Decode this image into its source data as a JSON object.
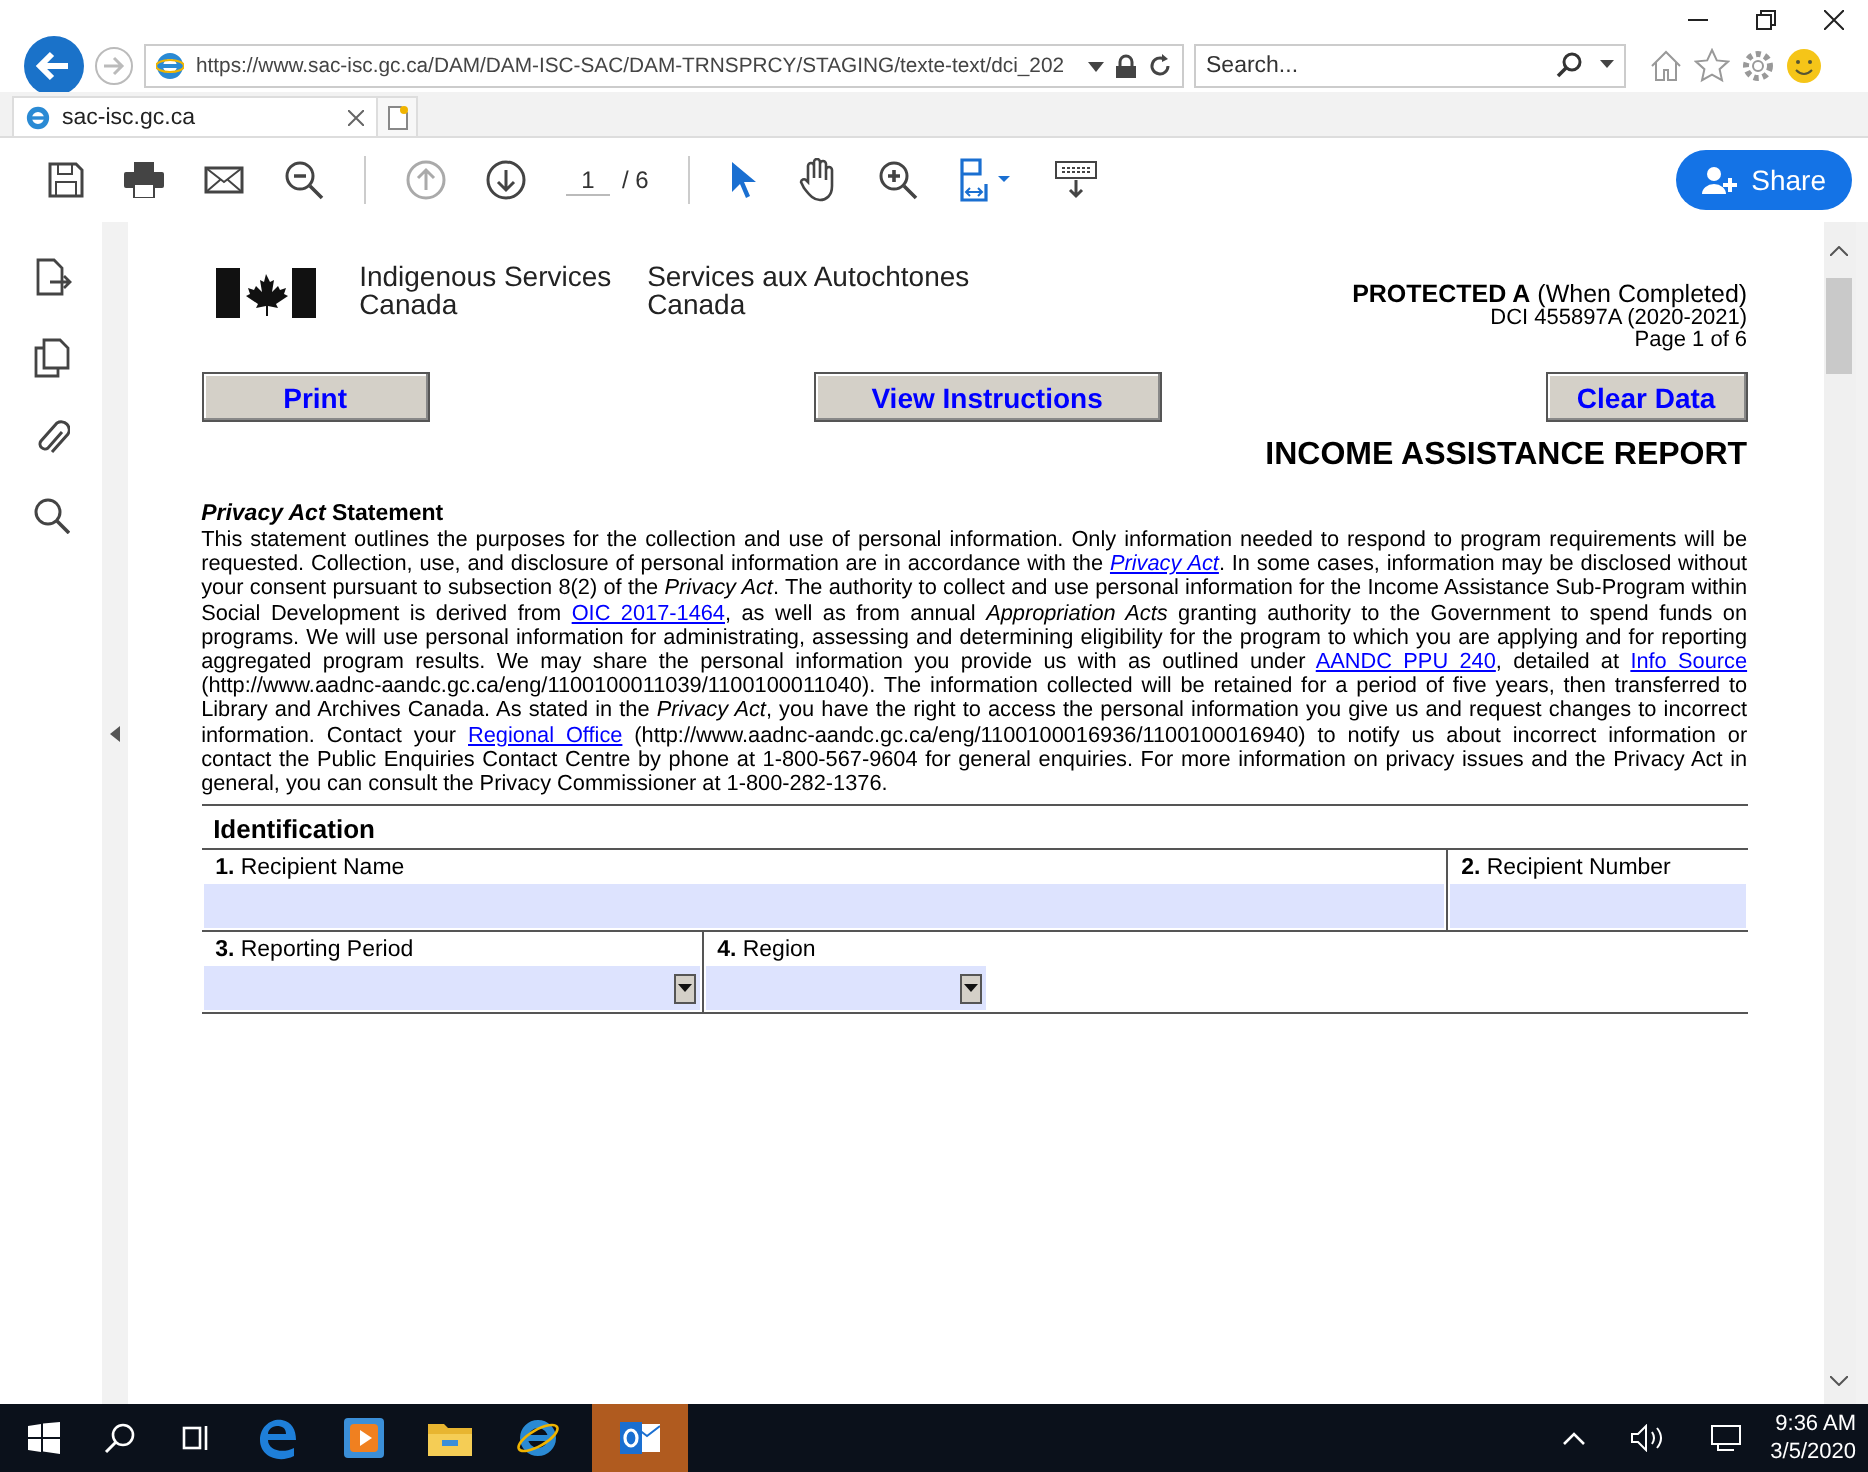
{
  "browser": {
    "url": "https://www.sac-isc.gc.ca/DAM/DAM-ISC-SAC/DAM-TRNSPRCY/STAGING/texte-text/dci_202",
    "search": {
      "placeholder": "Search..."
    },
    "tabs": [
      {
        "label": "sac-isc.gc.ca",
        "selected": true
      }
    ]
  },
  "pdf_toolbar": {
    "page_current": "1",
    "page_total": "/ 6",
    "share": "Share"
  },
  "document": {
    "org_en": [
      "Indigenous Services",
      "Canada"
    ],
    "org_fr": [
      "Services aux Autochtones",
      "Canada"
    ],
    "protected": "**PROTECTED A** (When Completed)",
    "form_number": "DCI 455897A (2020-2021)",
    "page": "Page 1 of 6",
    "buttons": [
      "Print",
      "View Instructions",
      "Clear Data"
    ],
    "title": "INCOME ASSISTANCE REPORT",
    "privacy_heading": "*Privacy Act* Statement",
    "privacy_text": [
      {
        "kind": "plain",
        "text": "This statement outlines the purposes for the collection and use of personal information. Only information needed to respond to program requirements will be requested. Collection, use, and disclosure of personal information are in accordance with the "
      },
      {
        "kind": "link",
        "text": "*Privacy Act*"
      },
      {
        "kind": "plain",
        "text": ". In some cases, information may be disclosed without your consent pursuant to subsection 8(2) of the *Privacy Act*. The authority to collect and use personal information for the Income Assistance Sub-Program within Social Development is derived from "
      },
      {
        "kind": "link",
        "text": "OIC 2017-1464"
      },
      {
        "kind": "plain",
        "text": ", as well as from annual *Appropriation Acts* granting authority to the Government to spend funds on programs. We will use personal information for administrating, assessing and determining eligibility for the program to which you are applying and for reporting aggregated program results. We may share the personal information you provide us with as outlined under "
      },
      {
        "kind": "link",
        "text": "AANDC PPU 240"
      },
      {
        "kind": "plain",
        "text": ", detailed at "
      },
      {
        "kind": "link",
        "text": "Info Source"
      },
      {
        "kind": "plain",
        "text": " (http://www.aadnc-aandc.gc.ca/eng/1100100011039/1100100011040). The information collected will be retained for a period of five years, then transferred to Library and Archives Canada. As stated in the *Privacy Act*, you have the right to access the personal information you give us and request changes to incorrect information. Contact your "
      },
      {
        "kind": "link",
        "text": "Regional Office"
      },
      {
        "kind": "plain",
        "text": " (http://www.aadnc-aandc.gc.ca/eng/1100100016936/1100100016940) to notify us about incorrect information or contact the Public Enquiries Contact Centre by phone at 1-800-567-9604 for general enquiries. For more information on privacy issues and the Privacy Act in general, you can consult the Privacy Commissioner at 1-800-282-1376."
      }
    ],
    "section": "Identification",
    "field_rows": [
      [
        {
          "label": "**1.** Recipient Name",
          "kind": "text"
        },
        {
          "label": "**2.** Recipient Number",
          "kind": "text"
        }
      ],
      [
        {
          "label": "**3.** Reporting Period",
          "kind": "dropdown"
        },
        {
          "label": "**4.** Region",
          "kind": "dropdown"
        }
      ]
    ]
  },
  "taskbar": {
    "time": "9:36 AM",
    "date": "3/5/2020"
  }
}
